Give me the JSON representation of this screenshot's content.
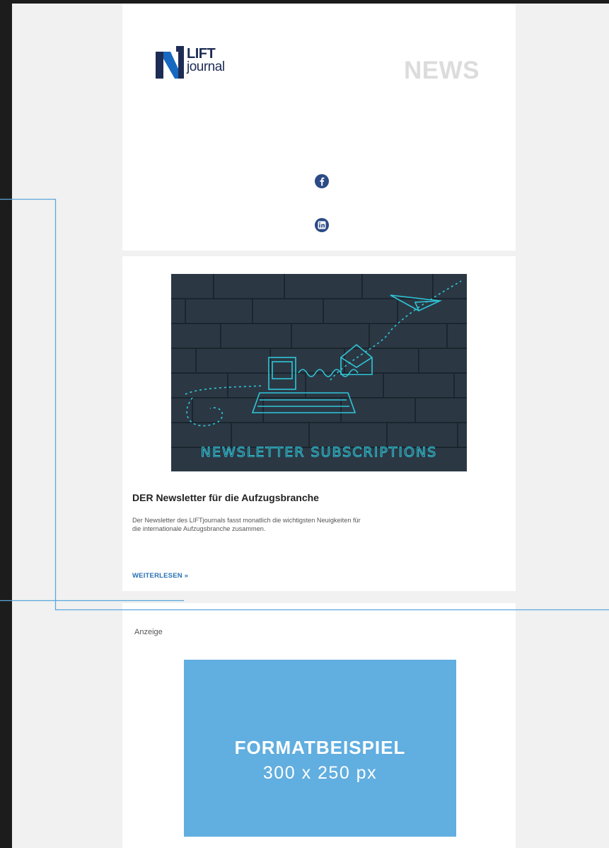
{
  "header": {
    "logo": {
      "line1": "LIFT",
      "line2": "journal",
      "brand_color": "#1d2c55",
      "accent_color": "#1769c0"
    },
    "section_label": "NEWS",
    "social": [
      {
        "icon": "facebook-icon"
      },
      {
        "icon": "linkedin-icon"
      }
    ]
  },
  "article": {
    "image": {
      "caption_text": "NEWSLETTER SUBSCRIPTIONS"
    },
    "title": "DER Newsletter für die Aufzugsbranche",
    "lines": [
      "Der Newsletter des LIFTjournals fasst monatlich die wichtigsten Neuigkeiten für",
      "die internationale Aufzugsbranche zusammen."
    ],
    "read_more": "WEITERLESEN »"
  },
  "ad": {
    "label": "Anzeige",
    "title": "FORMATBEISPIEL",
    "size": "300 x 250 px",
    "color": "#61aee0"
  },
  "colors": {
    "page_background": "#f1f1f1",
    "dark_frame": "#1c1c1c",
    "guide_line": "#5aa8dc",
    "link": "#2a71b3"
  }
}
